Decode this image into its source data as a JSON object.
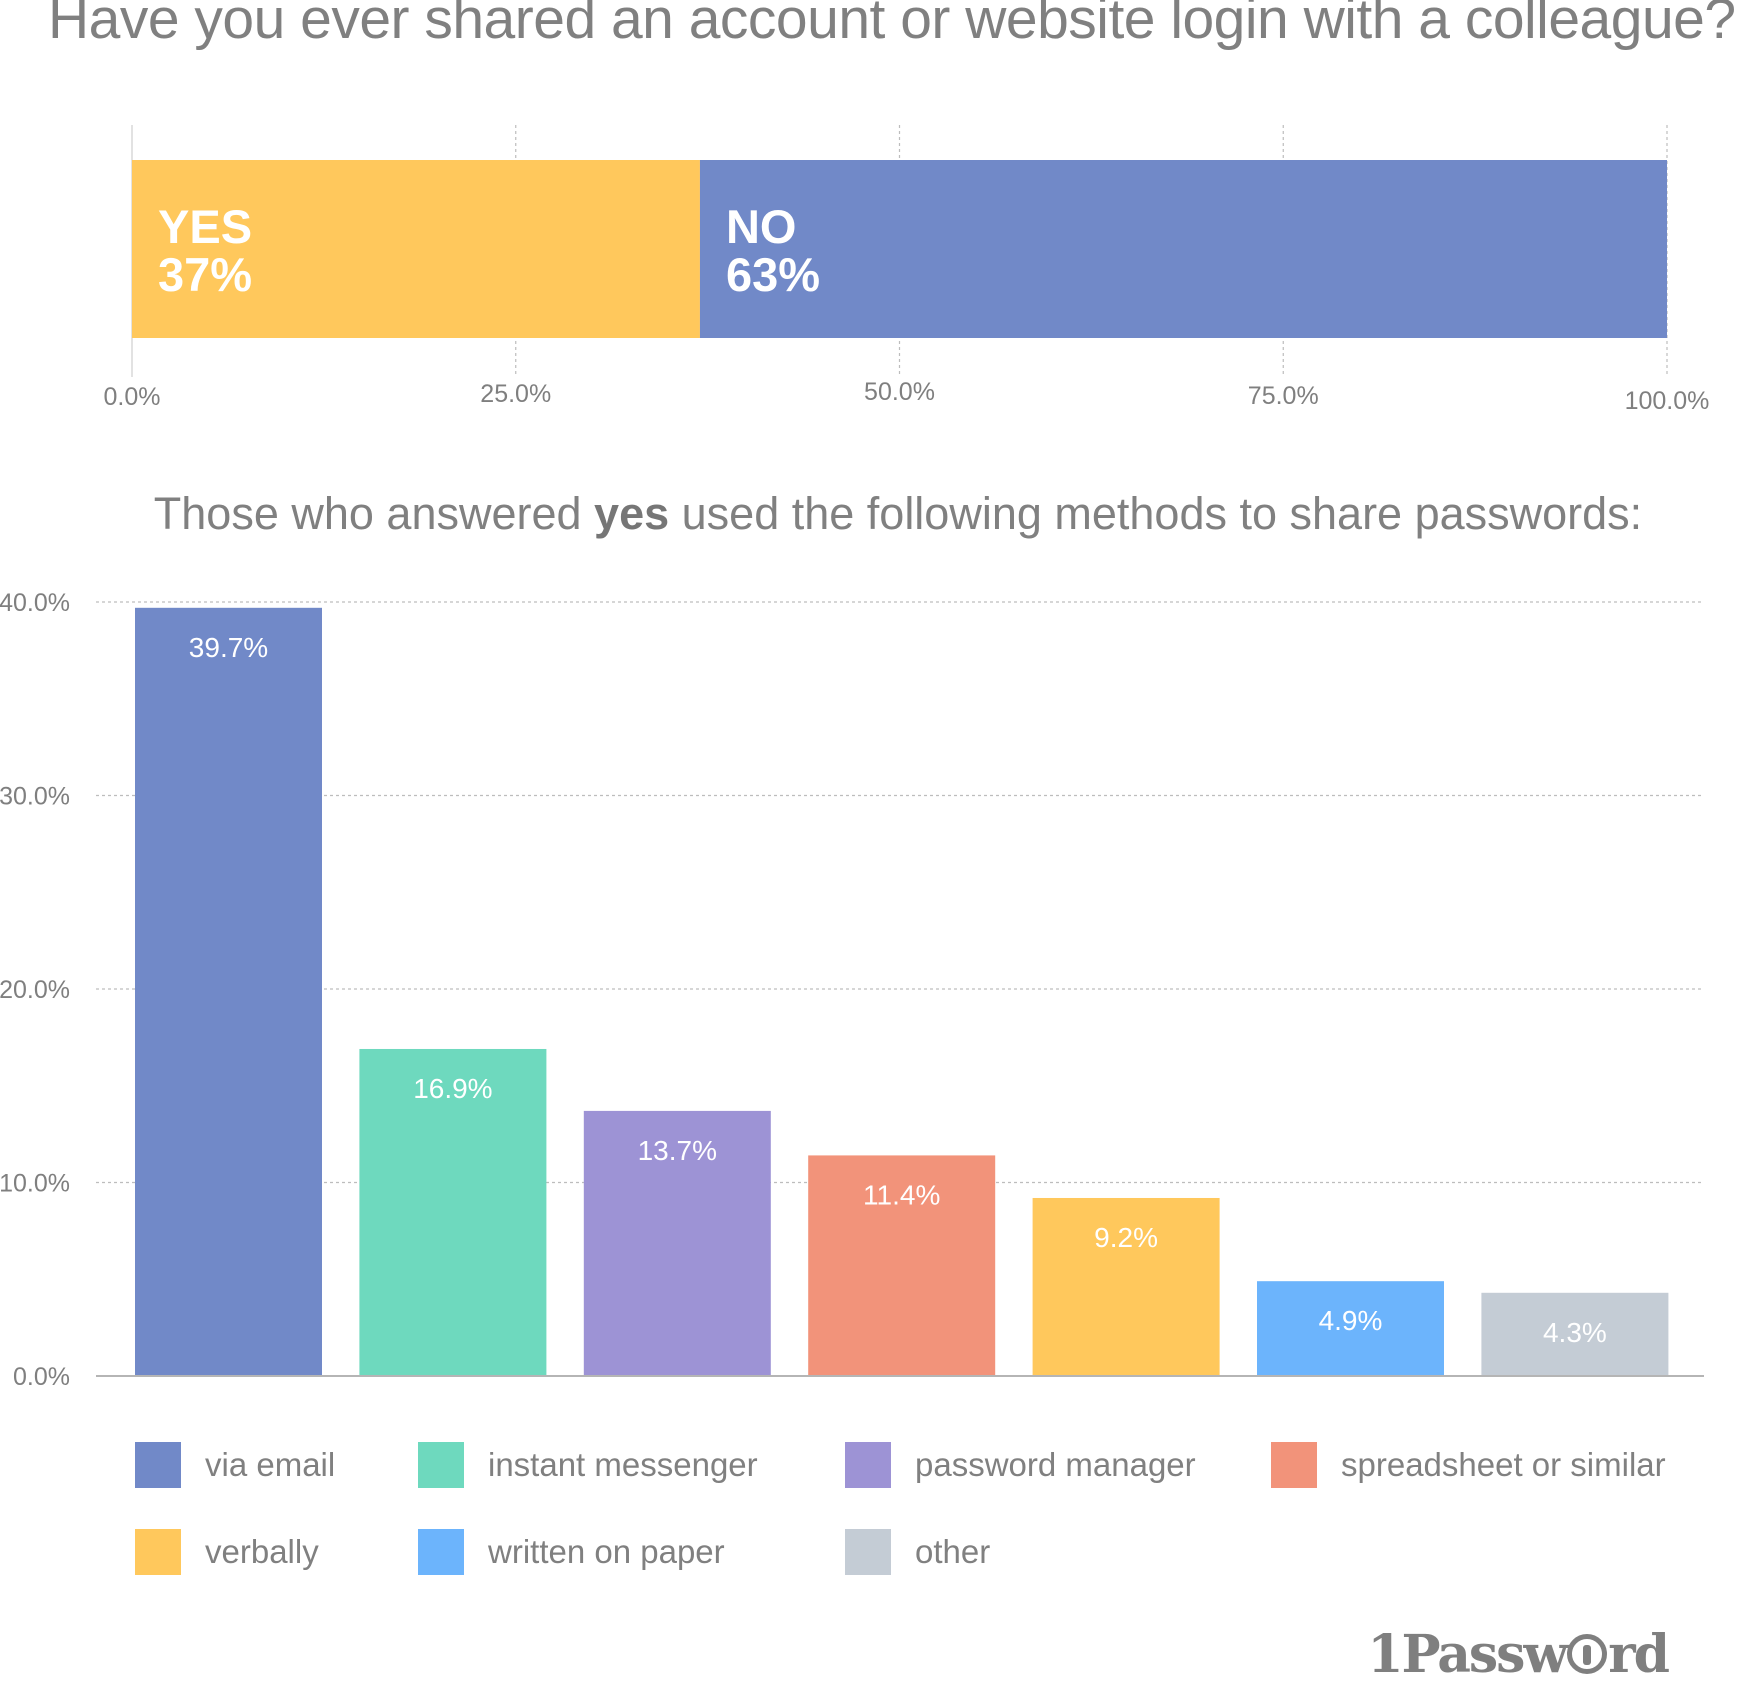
{
  "title": "Have you ever shared an account or website login with a colleague?",
  "subtitle": {
    "before": "Those who answered ",
    "bold": "yes",
    "after": " used the following methods to share passwords:"
  },
  "brand": {
    "logo_text_left": "1Passw",
    "logo_text_right": "rd",
    "logo_icon": "keyhole-icon"
  },
  "chart_data": [
    {
      "type": "bar",
      "orientation": "horizontal-stacked",
      "title": "Have you ever shared an account or website login with a colleague?",
      "xlim": [
        0,
        100
      ],
      "x_ticks": [
        0,
        25,
        50,
        75,
        100
      ],
      "x_tick_labels": [
        "0.0%",
        "25.0%",
        "50.0%",
        "75.0%",
        "100.0%"
      ],
      "grid": true,
      "series": [
        {
          "name": "YES",
          "value": 37,
          "label": "37%",
          "color": "#FFC85C"
        },
        {
          "name": "NO",
          "value": 63,
          "label": "63%",
          "color": "#7189C8"
        }
      ]
    },
    {
      "type": "bar",
      "title": "Those who answered yes used the following methods to share passwords:",
      "xlabel": "",
      "ylabel": "",
      "ylim": [
        0,
        40
      ],
      "y_ticks": [
        0,
        10,
        20,
        30,
        40
      ],
      "y_tick_labels": [
        "0.0%",
        "10.0%",
        "20.0%",
        "30.0%",
        "40.0%"
      ],
      "grid": true,
      "legend_placement": "bottom",
      "categories": [
        "via email",
        "instant messenger",
        "password manager",
        "spreadsheet or similar",
        "verbally",
        "written on paper",
        "other"
      ],
      "values": [
        39.7,
        16.9,
        13.7,
        11.4,
        9.2,
        4.9,
        4.3
      ],
      "value_labels": [
        "39.7%",
        "16.9%",
        "13.7%",
        "11.4%",
        "9.2%",
        "4.9%",
        "4.3%"
      ],
      "colors": [
        "#7189C8",
        "#6ED9BE",
        "#9D93D5",
        "#F2937A",
        "#FFC85C",
        "#6CB4FC",
        "#C4CCD5"
      ]
    }
  ]
}
